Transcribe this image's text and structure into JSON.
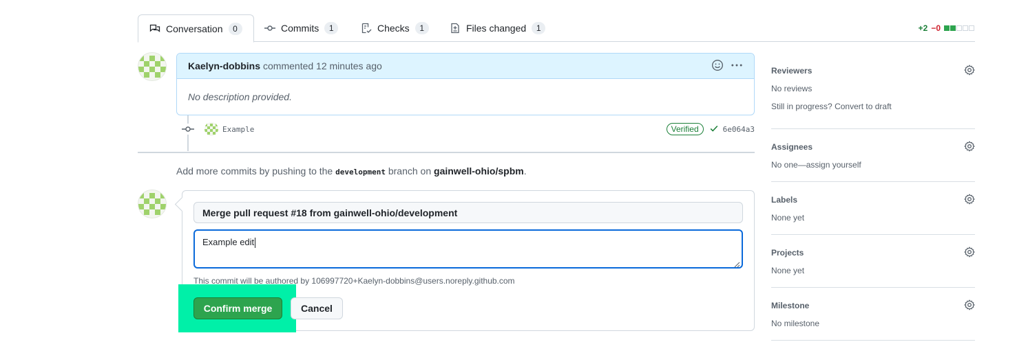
{
  "tabs": [
    {
      "label": "Conversation",
      "count": "0",
      "icon": "comment-discussion-icon"
    },
    {
      "label": "Commits",
      "count": "1",
      "icon": "git-commit-icon"
    },
    {
      "label": "Checks",
      "count": "1",
      "icon": "checklist-icon"
    },
    {
      "label": "Files changed",
      "count": "1",
      "icon": "file-diff-icon"
    }
  ],
  "diffstat": {
    "additions": "+2",
    "deletions": "−0"
  },
  "comment": {
    "author": "Kaelyn-dobbins",
    "action": "commented 12 minutes ago",
    "body": "No description provided."
  },
  "commit": {
    "message": "Example",
    "verified": "Verified",
    "sha": "6e064a3"
  },
  "push_note": {
    "prefix": "Add more commits by pushing to the ",
    "branch": "development",
    "middle": " branch on ",
    "repo": "gainwell-ohio/spbm",
    "suffix": "."
  },
  "merge": {
    "title": "Merge pull request #18 from gainwell-ohio/development",
    "body": "Example edit",
    "author_note": "This commit will be authored by 106997720+Kaelyn-dobbins@users.noreply.github.com",
    "confirm_label": "Confirm merge",
    "cancel_label": "Cancel"
  },
  "sidebar": {
    "reviewers": {
      "heading": "Reviewers",
      "value": "No reviews",
      "draft_prefix": "Still in progress?",
      "draft_link": "Convert to draft"
    },
    "assignees": {
      "heading": "Assignees",
      "value": "No one—assign yourself"
    },
    "labels": {
      "heading": "Labels",
      "value": "None yet"
    },
    "projects": {
      "heading": "Projects",
      "value": "None yet"
    },
    "milestone": {
      "heading": "Milestone",
      "value": "No milestone"
    }
  },
  "colors": {
    "accent_green": "#2da44e",
    "highlight": "#00f0a8",
    "focus_blue": "#0969da"
  }
}
